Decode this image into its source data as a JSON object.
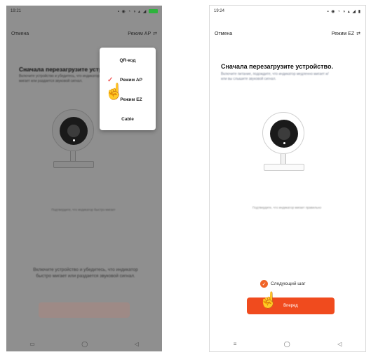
{
  "left": {
    "status_time": "19:21",
    "cancel_label": "Отмена",
    "mode_label": "Режим AP",
    "mode_icon": "swap-icon",
    "title": "Сначала перезагрузите устройство.",
    "description": "Включите устройство и убедитесь, что индикатор быстро мигает или раздается звуковой сигнал.",
    "hint": "Подтвердите, что индикатор быстро мигает",
    "bottom_text": "Включите устройство и убедитесь, что индикатор быстро мигает или раздается звуковой сигнал.",
    "popup": {
      "items": [
        {
          "label": "QR-код"
        },
        {
          "label": "Режим AP",
          "selected": true
        },
        {
          "label": "Режим EZ"
        },
        {
          "label": "Cable"
        }
      ]
    },
    "nav": [
      "▭",
      "◯",
      "◁"
    ]
  },
  "right": {
    "status_time": "19:24",
    "cancel_label": "Отмена",
    "mode_label": "Режим EZ",
    "title": "Сначала перезагрузите устройство.",
    "description": "Включите питание, подождите, что индикатор медленно мигает и/или вы слышите звуковой сигнал.",
    "hint": "Подтвердите, что индикатор мигает правильно",
    "next_step_label": "Следующий шаг",
    "next_button_label": "Вперед",
    "nav": [
      "≡",
      "◯",
      "◁"
    ]
  },
  "colors": {
    "accent": "#f04b1e",
    "check": "#f05a5a",
    "hand": "#22a84a"
  }
}
